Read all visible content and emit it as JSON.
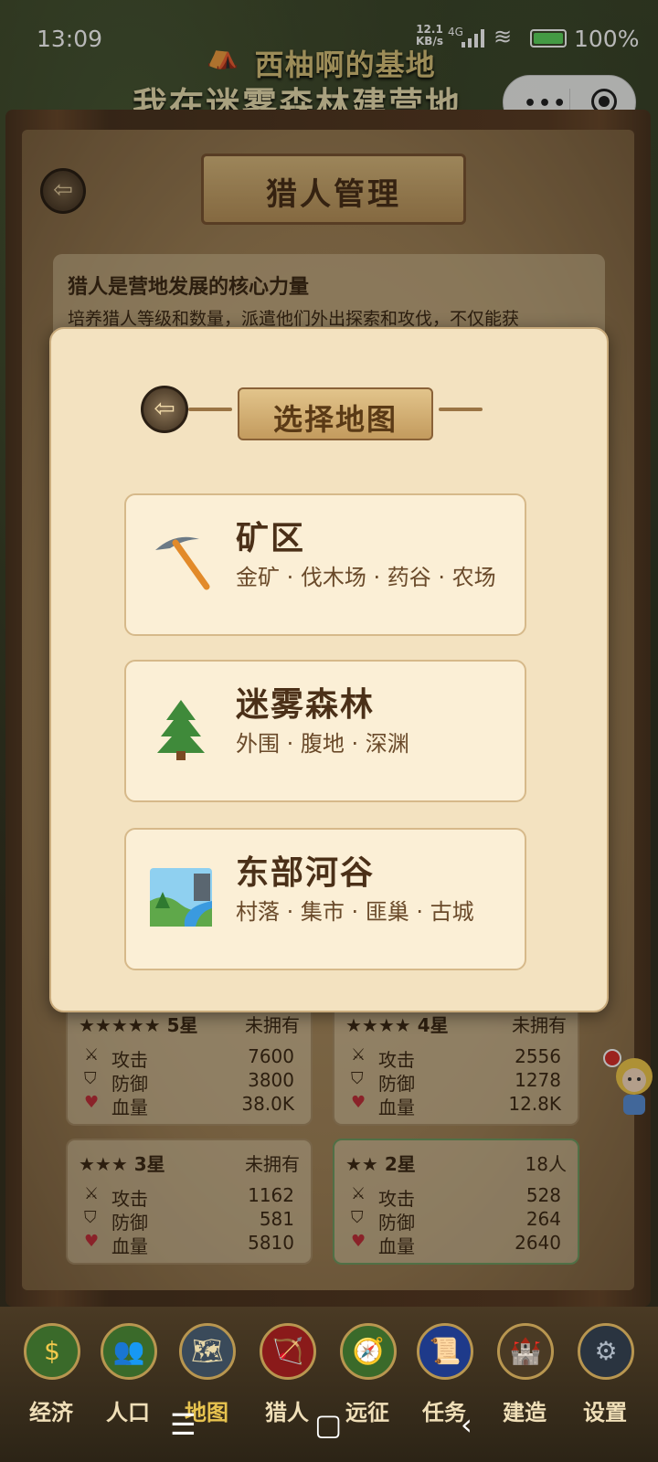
{
  "status": {
    "time": "13:09",
    "net_speed": "12.1",
    "net_unit": "KB/s",
    "signal": "4G",
    "battery": "100%"
  },
  "header": {
    "camp_name": "西柚啊的基地",
    "subtitle": "我在迷雾森林建营地"
  },
  "page": {
    "title": "猎人管理"
  },
  "info": {
    "heading": "猎人是营地发展的核心力量",
    "text": "培养猎人等级和数量，派遣他们外出探索和攻伐，不仅能获"
  },
  "hunters": [
    {
      "stars": "★★★★★",
      "stars_label": "5星",
      "own": "未拥有",
      "attack": "7600",
      "defense": "3800",
      "hp": "38.0K"
    },
    {
      "stars": "★★★★",
      "stars_label": "4星",
      "own": "未拥有",
      "attack": "2556",
      "defense": "1278",
      "hp": "12.8K"
    },
    {
      "stars": "★★★",
      "stars_label": "3星",
      "own": "未拥有",
      "attack": "1162",
      "defense": "581",
      "hp": "5810"
    },
    {
      "stars": "★★",
      "stars_label": "2星",
      "own": "18人",
      "attack": "528",
      "defense": "264",
      "hp": "2640"
    }
  ],
  "stat_labels": {
    "attack": "攻击",
    "defense": "防御",
    "hp": "血量"
  },
  "modal": {
    "title": "选择地图",
    "maps": [
      {
        "name": "矿区",
        "areas": "金矿 · 伐木场 · 药谷 · 农场",
        "icon": "pickaxe-icon"
      },
      {
        "name": "迷雾森林",
        "areas": "外围 · 腹地 · 深渊",
        "icon": "evergreen-tree-icon"
      },
      {
        "name": "东部河谷",
        "areas": "村落 · 集市 · 匪巢 · 古城",
        "icon": "river-valley-icon"
      }
    ]
  },
  "nav": [
    {
      "label": "经济",
      "icon": "coin-icon"
    },
    {
      "label": "人口",
      "icon": "people-icon"
    },
    {
      "label": "地图",
      "icon": "map-icon"
    },
    {
      "label": "猎人",
      "icon": "bow-icon"
    },
    {
      "label": "远征",
      "icon": "compass-icon"
    },
    {
      "label": "任务",
      "icon": "scroll-icon"
    },
    {
      "label": "建造",
      "icon": "castle-icon"
    },
    {
      "label": "设置",
      "icon": "gear-icon"
    }
  ]
}
